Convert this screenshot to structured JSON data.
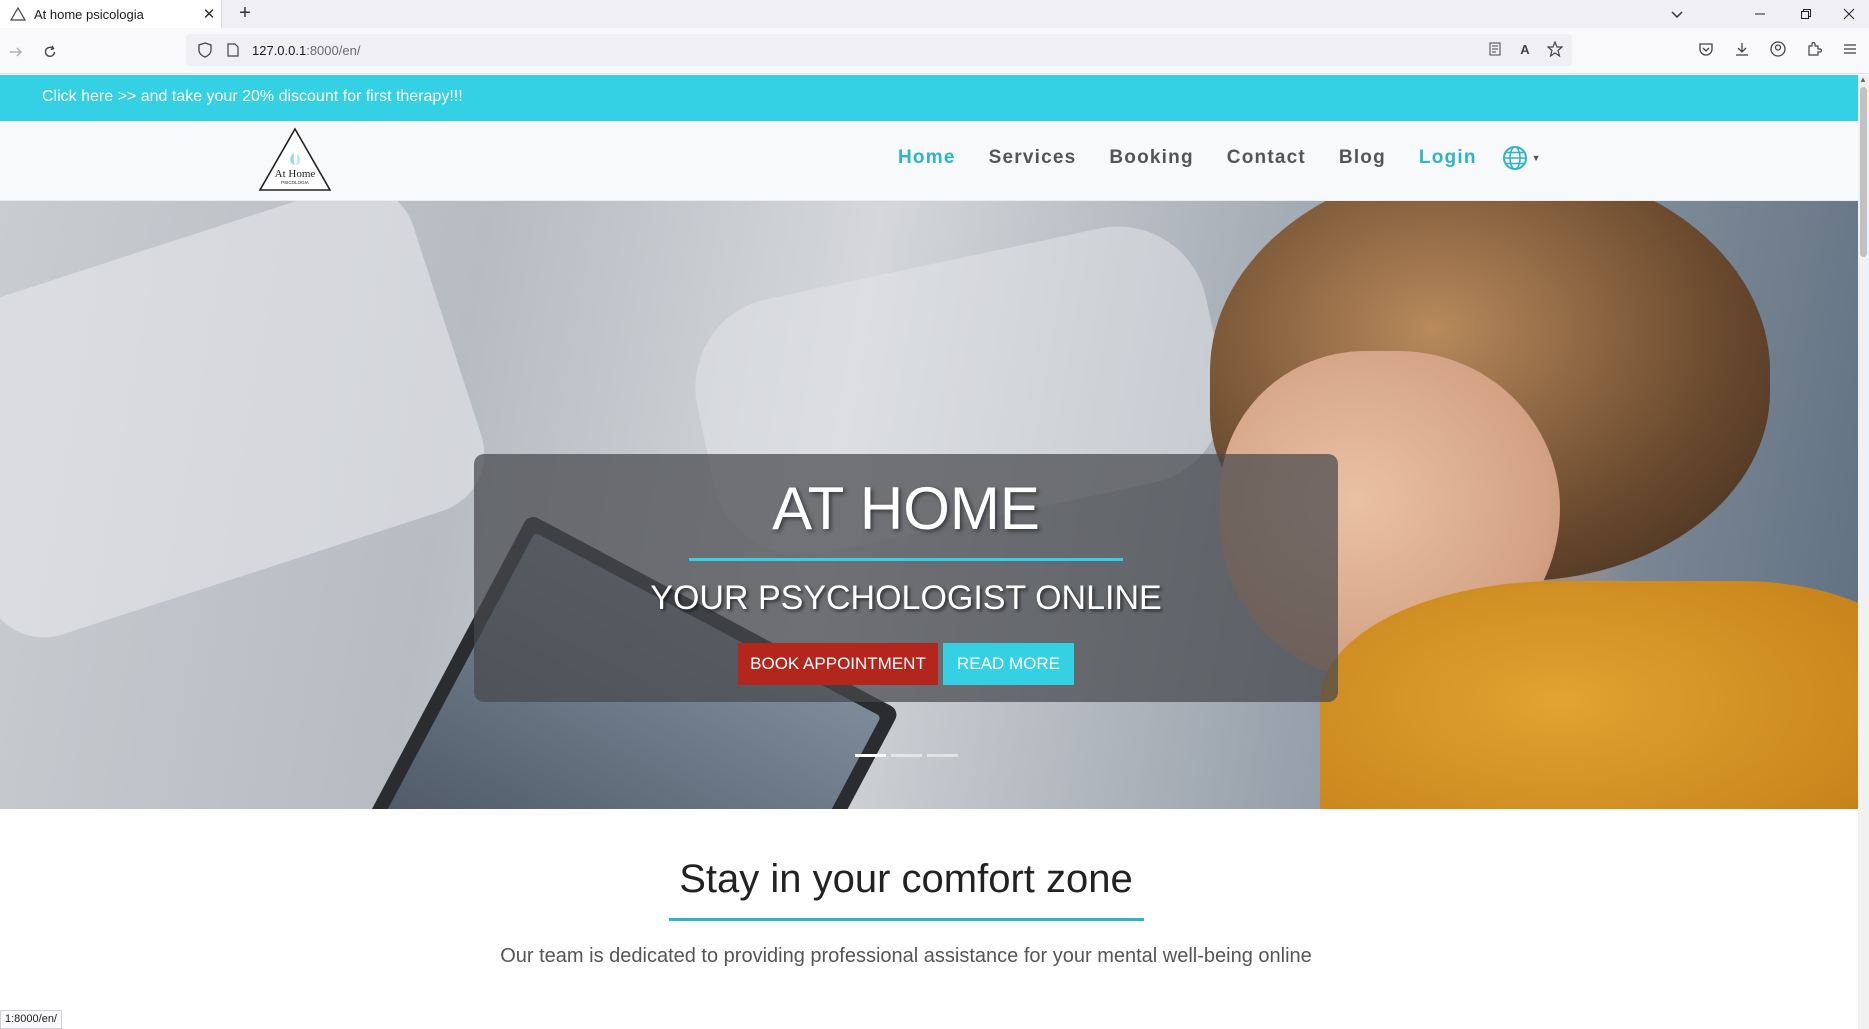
{
  "browser": {
    "tab_title": "At home psicologia",
    "tab_close": "✕",
    "new_tab": "+",
    "url_host": "127.0.0.1",
    "url_rest": ":8000/en/",
    "status_url": "1:8000/en/"
  },
  "promo": {
    "text": "Click here >> and take your 20% discount for first therapy!!!"
  },
  "logo": {
    "line1": "At Home",
    "line2": "PSICOLOGIA"
  },
  "nav": {
    "home": "Home",
    "services": "Services",
    "booking": "Booking",
    "contact": "Contact",
    "blog": "Blog",
    "login": "Login",
    "language_icon": "globe-icon"
  },
  "hero": {
    "title": "AT HOME",
    "subtitle": "YOUR PSYCHOLOGIST ONLINE",
    "book_label": "BOOK APPOINTMENT",
    "read_label": "READ MORE",
    "slides_total": 3,
    "active_slide": 1
  },
  "section": {
    "heading": "Stay in your comfort zone",
    "text": "Our team is dedicated to providing professional assistance for your mental well-being online"
  },
  "colors": {
    "accent": "#34d0e4",
    "nav_active": "#2fb4c6",
    "book_button": "#b3261e"
  }
}
